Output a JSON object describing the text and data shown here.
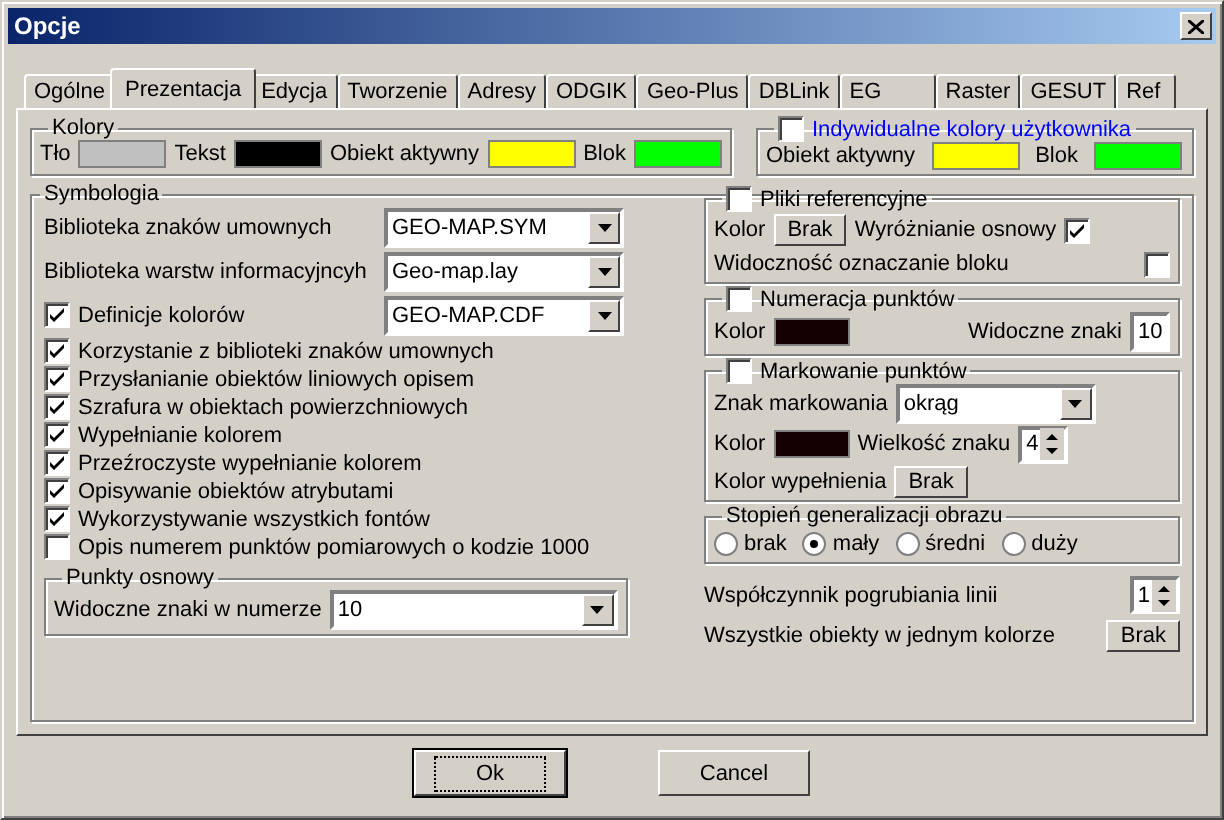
{
  "window": {
    "title": "Opcje"
  },
  "tabs": [
    {
      "label": "Ogólne",
      "selected": false
    },
    {
      "label": "Prezentacja",
      "selected": true
    },
    {
      "label": "Edycja",
      "selected": false
    },
    {
      "label": "Tworzenie",
      "selected": false
    },
    {
      "label": "Adresy",
      "selected": false
    },
    {
      "label": "ODGIK",
      "selected": false
    },
    {
      "label": "Geo-Plus",
      "selected": false
    },
    {
      "label": "DBLink",
      "selected": false
    },
    {
      "label": "EG",
      "selected": false
    },
    {
      "label": "Raster",
      "selected": false
    },
    {
      "label": "GESUT",
      "selected": false
    },
    {
      "label": "Ref",
      "selected": false
    }
  ],
  "colors": {
    "title": "Kolory",
    "swatches": [
      {
        "label": "Tło",
        "color": "#c0c0c0"
      },
      {
        "label": "Tekst",
        "color": "#000000"
      },
      {
        "label": "Obiekt aktywny",
        "color": "#ffff00"
      },
      {
        "label": "Blok",
        "color": "#00ff00"
      }
    ]
  },
  "user_colors": {
    "label": "Indywidualne kolory użytkownika",
    "checked": false,
    "swatches": [
      {
        "label": "Obiekt aktywny",
        "color": "#ffff00"
      },
      {
        "label": "Blok",
        "color": "#00ff00"
      }
    ]
  },
  "symbology": {
    "title": "Symbologia",
    "combos": [
      {
        "kind": "plain",
        "label": "Biblioteka znaków umownych",
        "value": "GEO-MAP.SYM"
      },
      {
        "kind": "plain",
        "label": "Biblioteka warstw informacyjncyh",
        "value": "Geo-map.lay"
      },
      {
        "kind": "check",
        "label": "Definicje kolorów",
        "checked": true,
        "value": "GEO-MAP.CDF"
      }
    ],
    "checks": [
      {
        "label": "Korzystanie z biblioteki znaków umownych",
        "checked": true
      },
      {
        "label": "Przysłanianie obiektów liniowych opisem",
        "checked": true
      },
      {
        "label": "Szrafura w obiektach powierzchniowych",
        "checked": true
      },
      {
        "label": "Wypełnianie kolorem",
        "checked": true
      },
      {
        "label": "Przeźroczyste wypełnianie kolorem",
        "checked": true
      },
      {
        "label": "Opisywanie obiektów atrybutami",
        "checked": true
      },
      {
        "label": "Wykorzystywanie wszystkich fontów",
        "checked": true
      },
      {
        "label": "Opis numerem punktów pomiarowych o kodzie 1000",
        "checked": false
      }
    ],
    "base_points": {
      "title": "Punkty osnowy",
      "label": "Widoczne znaki w numerze",
      "value": "10"
    }
  },
  "reference_files": {
    "label": "Pliki referencyjne",
    "checked": false,
    "color_label": "Kolor",
    "color_button": "Brak",
    "highlight_label": "Wyróżnianie osnowy",
    "highlight_checked": true,
    "block_label": "Widoczność oznaczanie bloku",
    "block_checked": false
  },
  "point_numbering": {
    "label": "Numeracja punktów",
    "checked": false,
    "color_label": "Kolor",
    "color": "#140000",
    "visible_label": "Widoczne znaki",
    "visible_value": "10"
  },
  "point_marking": {
    "label": "Markowanie punktów",
    "checked": false,
    "sign_label": "Znak markowania",
    "sign_value": "okrąg",
    "color_label": "Kolor",
    "color": "#140000",
    "size_label": "Wielkość znaku",
    "size_value": "4",
    "fill_label": "Kolor wypełnienia",
    "fill_button": "Brak"
  },
  "generalization": {
    "title": "Stopień generalizacji obrazu",
    "options": [
      {
        "label": "brak",
        "selected": false
      },
      {
        "label": "mały",
        "selected": true
      },
      {
        "label": "średni",
        "selected": false
      },
      {
        "label": "duży",
        "selected": false
      }
    ]
  },
  "line_factor": {
    "label": "Współczynnik pogrubiania linii",
    "value": "1"
  },
  "one_color": {
    "label": "Wszystkie obiekty w jednym kolorze",
    "button": "Brak"
  },
  "buttons": [
    {
      "label": "Ok",
      "default": true
    },
    {
      "label": "Cancel",
      "default": false
    }
  ]
}
